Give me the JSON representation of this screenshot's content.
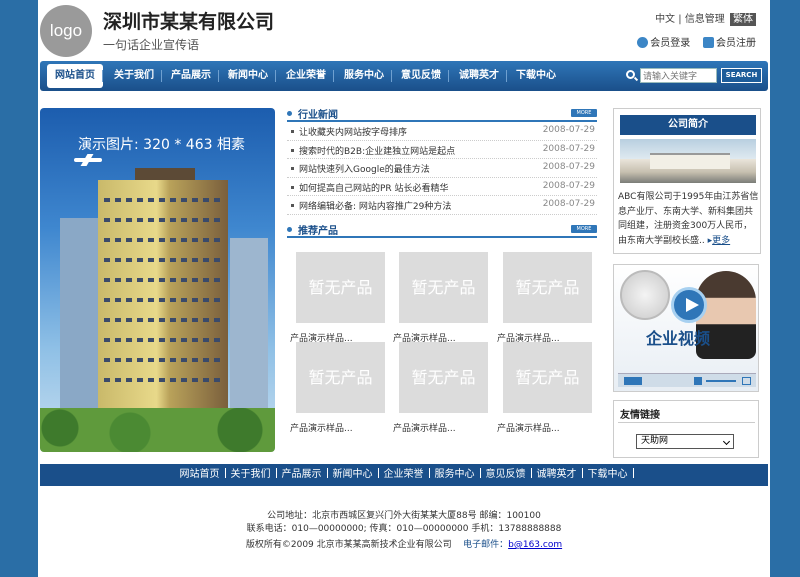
{
  "header": {
    "logo": "logo",
    "title": "深圳市某某有限公司",
    "slogan": "一句话企业宣传语",
    "lang_cn": "中文",
    "divider": "|",
    "info_manage": "信息管理",
    "traditional": "繁体",
    "login": "会员登录",
    "register": "会员注册"
  },
  "nav": {
    "items": [
      "网站首页",
      "关于我们",
      "产品展示",
      "新闻中心",
      "企业荣誉",
      "服务中心",
      "意见反馈",
      "诚聘英才",
      "下载中心"
    ],
    "search_placeholder": "请输入关键字",
    "search_button": "SEARCH"
  },
  "banner": {
    "caption": "演示图片: 320 * 463 相素"
  },
  "news": {
    "title": "行业新闻",
    "more": "MORE",
    "items": [
      {
        "title": "让收藏夹内网站按字母排序",
        "date": "2008-07-29"
      },
      {
        "title": "搜索时代的B2B:企业建独立网站是起点",
        "date": "2008-07-29"
      },
      {
        "title": "网站快速列入Google的最佳方法",
        "date": "2008-07-29"
      },
      {
        "title": "如何提高自己网站的PR 站长必看精华",
        "date": "2008-07-29"
      },
      {
        "title": "网络编辑必备: 网站内容推广29种方法",
        "date": "2008-07-29"
      }
    ]
  },
  "products": {
    "title": "推荐产品",
    "more": "MORE",
    "placeholder": "暂无产品",
    "items": [
      "产品演示样品...",
      "产品演示样品...",
      "产品演示样品...",
      "产品演示样品...",
      "产品演示样品...",
      "产品演示样品..."
    ]
  },
  "intro": {
    "title": "公司简介",
    "text": "ABC有限公司于1995年由江苏省信息产业厅、东南大学、新科集团共同组建，注册资金300万人民币，由东南大学副校长盛..",
    "more": "更多"
  },
  "video": {
    "label": "企业视频"
  },
  "friend_links": {
    "title": "友情链接",
    "selected": "天助网"
  },
  "footer_nav": [
    "网站首页",
    "关于我们",
    "产品展示",
    "新闻中心",
    "企业荣誉",
    "服务中心",
    "意见反馈",
    "诚聘英才",
    "下载中心"
  ],
  "footer": {
    "address": "公司地址：北京市西城区复兴门外大街某某大厦88号    邮编：100100",
    "contact": "联系电话：010—00000000;    传真：010—00000000    手机：13788888888",
    "copyright": "版权所有©2009 北京市某某高新技术企业有限公司",
    "email_label": "电子邮件：",
    "email": "b@163.com"
  },
  "colors": {
    "brand": "#1a4f8a",
    "accent": "#2f76b8",
    "outer_bg": "#2a6ea6"
  }
}
